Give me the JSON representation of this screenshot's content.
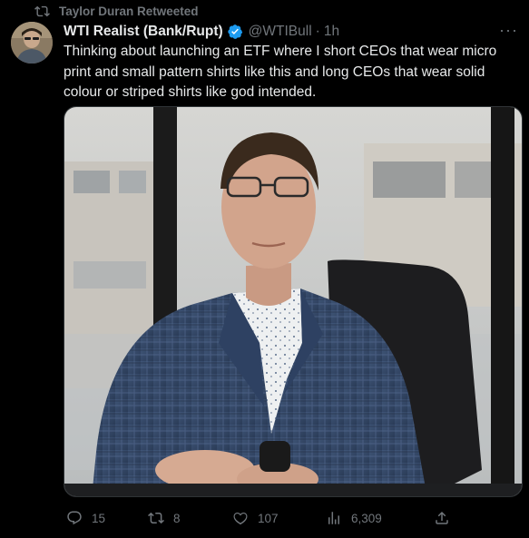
{
  "retweet_context": {
    "text": "Taylor Duran Retweeted",
    "icon": "retweet-icon"
  },
  "author": {
    "display_name": "WTI Realist (Bank/Rupt)",
    "verified": true,
    "handle": "@WTIBull",
    "separator": "·",
    "time": "1h",
    "avatar_icon": "user-avatar"
  },
  "more_menu": {
    "icon": "more-dots-icon",
    "label": "···"
  },
  "tweet_text": "Thinking about launching an ETF where I short CEOs that wear micro print and small pattern shirts like this and long CEOs that wear solid colour or striped shirts like god intended.",
  "media": {
    "type": "photo",
    "subject": "man in blue plaid blazer and patterned shirt seated in office chair"
  },
  "actions": {
    "reply": {
      "icon": "reply-icon",
      "count": "15"
    },
    "retweet": {
      "icon": "retweet-icon",
      "count": "8"
    },
    "like": {
      "icon": "heart-icon",
      "count": "107"
    },
    "views": {
      "icon": "views-bar-icon",
      "count": "6,309"
    },
    "share": {
      "icon": "share-icon"
    }
  },
  "colors": {
    "background": "#000000",
    "primary_text": "#e7e9ea",
    "secondary_text": "#71767b",
    "verified_blue": "#1d9bf0"
  }
}
